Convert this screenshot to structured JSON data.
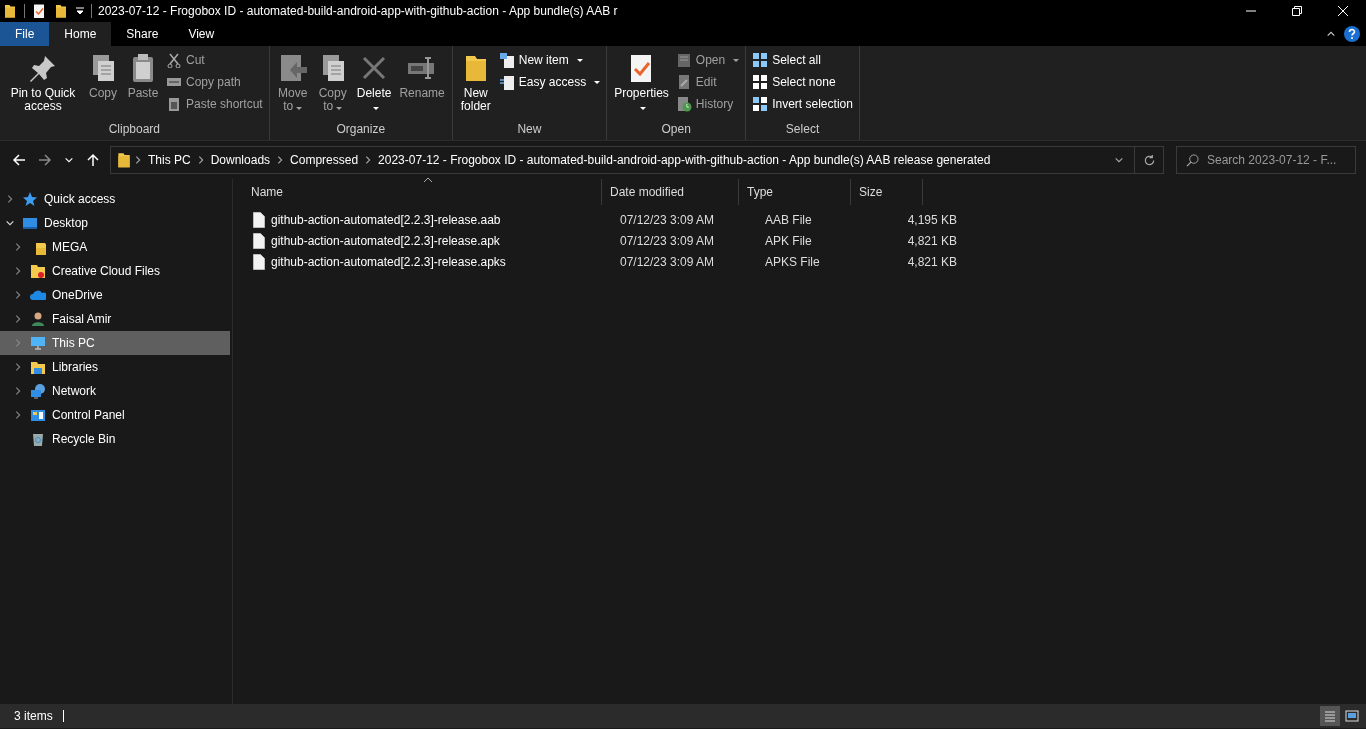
{
  "window": {
    "title": "2023-07-12 - Frogobox ID - automated-build-android-app-with-github-action - App bundle(s) AAB r"
  },
  "tabs": [
    {
      "label": "File",
      "kind": "file",
      "selected": false
    },
    {
      "label": "Home",
      "kind": "tab",
      "selected": true
    },
    {
      "label": "Share",
      "kind": "tab",
      "selected": false
    },
    {
      "label": "View",
      "kind": "tab",
      "selected": false
    }
  ],
  "ribbon": {
    "groups": [
      {
        "label": "Clipboard",
        "items": [
          {
            "kind": "large",
            "label": "Pin to Quick access",
            "disabled": false,
            "dropdown": false
          },
          {
            "kind": "large",
            "label": "Copy",
            "disabled": true,
            "dropdown": false
          },
          {
            "kind": "large",
            "label": "Paste",
            "disabled": true,
            "dropdown": false
          },
          {
            "kind": "small",
            "label": "Cut",
            "disabled": true,
            "dropdown": false
          },
          {
            "kind": "small",
            "label": "Copy path",
            "disabled": true,
            "dropdown": false
          },
          {
            "kind": "small",
            "label": "Paste shortcut",
            "disabled": true,
            "dropdown": false
          }
        ]
      },
      {
        "label": "Organize",
        "items": [
          {
            "kind": "large",
            "label": "Move to",
            "disabled": true,
            "dropdown": true
          },
          {
            "kind": "large",
            "label": "Copy to",
            "disabled": true,
            "dropdown": true
          },
          {
            "kind": "large",
            "label": "Delete",
            "disabled": false,
            "dropdown": true
          },
          {
            "kind": "large",
            "label": "Rename",
            "disabled": true,
            "dropdown": false
          }
        ]
      },
      {
        "label": "New",
        "items": [
          {
            "kind": "large",
            "label": "New folder",
            "disabled": false,
            "dropdown": false
          },
          {
            "kind": "small",
            "label": "New item",
            "disabled": false,
            "dropdown": true
          },
          {
            "kind": "small",
            "label": "Easy access",
            "disabled": false,
            "dropdown": true
          }
        ]
      },
      {
        "label": "Open",
        "items": [
          {
            "kind": "large",
            "label": "Properties",
            "disabled": false,
            "dropdown": true
          },
          {
            "kind": "small",
            "label": "Open",
            "disabled": true,
            "dropdown": true
          },
          {
            "kind": "small",
            "label": "Edit",
            "disabled": true,
            "dropdown": false
          },
          {
            "kind": "small",
            "label": "History",
            "disabled": true,
            "dropdown": false
          }
        ]
      },
      {
        "label": "Select",
        "items": [
          {
            "kind": "small",
            "label": "Select all",
            "disabled": false,
            "dropdown": false
          },
          {
            "kind": "small",
            "label": "Select none",
            "disabled": false,
            "dropdown": false
          },
          {
            "kind": "small",
            "label": "Invert selection",
            "disabled": false,
            "dropdown": false
          }
        ]
      }
    ]
  },
  "address": {
    "crumbs": [
      "This PC",
      "Downloads",
      "Compressed",
      "2023-07-12 - Frogobox ID - automated-build-android-app-with-github-action - App bundle(s) AAB release generated"
    ]
  },
  "search": {
    "placeholder": "Search 2023-07-12 - F..."
  },
  "navigation": [
    {
      "label": "Quick access",
      "expandable": true,
      "expanded": false,
      "selected": false
    },
    {
      "label": "Desktop",
      "expandable": true,
      "expanded": true,
      "selected": false,
      "children": [
        {
          "label": "MEGA",
          "expandable": true,
          "expanded": false,
          "selected": false
        },
        {
          "label": "Creative Cloud Files",
          "expandable": true,
          "expanded": false,
          "selected": false
        },
        {
          "label": "OneDrive",
          "expandable": true,
          "expanded": false,
          "selected": false
        },
        {
          "label": "Faisal Amir",
          "expandable": true,
          "expanded": false,
          "selected": false
        },
        {
          "label": "This PC",
          "expandable": true,
          "expanded": false,
          "selected": true
        },
        {
          "label": "Libraries",
          "expandable": true,
          "expanded": false,
          "selected": false
        },
        {
          "label": "Network",
          "expandable": true,
          "expanded": false,
          "selected": false
        },
        {
          "label": "Control Panel",
          "expandable": true,
          "expanded": false,
          "selected": false
        },
        {
          "label": "Recycle Bin",
          "expandable": false,
          "expanded": false,
          "selected": false
        }
      ]
    }
  ],
  "table": {
    "columns": [
      "Name",
      "Date modified",
      "Type",
      "Size"
    ],
    "rows": [
      {
        "name": "github-action-automated[2.2.3]-release.aab",
        "date": "07/12/23 3:09 AM",
        "type": "AAB File",
        "size": "4,195 KB"
      },
      {
        "name": "github-action-automated[2.2.3]-release.apk",
        "date": "07/12/23 3:09 AM",
        "type": "APK File",
        "size": "4,821 KB"
      },
      {
        "name": "github-action-automated[2.2.3]-release.apks",
        "date": "07/12/23 3:09 AM",
        "type": "APKS File",
        "size": "4,821 KB"
      }
    ]
  },
  "status_bar": {
    "text": "3 items"
  },
  "view_buttons": [
    {
      "kind": "details",
      "selected": true
    },
    {
      "kind": "tiles",
      "selected": false
    }
  ]
}
